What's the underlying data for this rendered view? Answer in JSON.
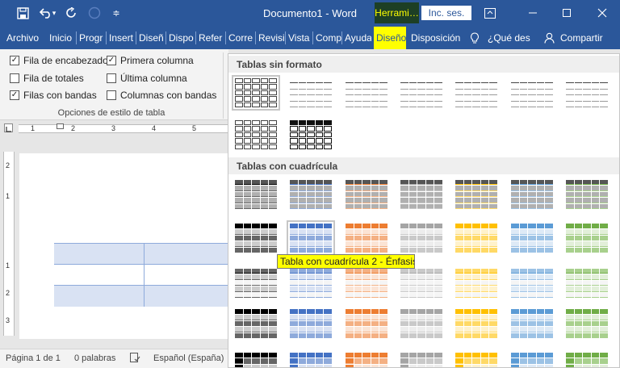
{
  "window": {
    "title": "Documento1  -  Word",
    "contextual_tools": "Herrami…",
    "signin": "Inc. ses."
  },
  "qat": {
    "icons": [
      "save-icon",
      "undo-icon",
      "undo-dropdown-icon",
      "redo-icon",
      "touch-mode-icon",
      "customize-qat-icon"
    ]
  },
  "menu": {
    "tabs": [
      "Archivo",
      "Inicio",
      "Progr",
      "Insert",
      "Diseñ",
      "Dispo",
      "Refer",
      "Corre",
      "Revisi",
      "Vista",
      "Comp",
      "Ayuda",
      "Diseño",
      "Disposición"
    ],
    "active_tab": "Diseño",
    "tell_me": "¿Qué des",
    "share": "Compartir"
  },
  "ribbon": {
    "options": [
      {
        "label": "Fila de encabezado",
        "checked": true
      },
      {
        "label": "Primera columna",
        "checked": true
      },
      {
        "label": "Fila de totales",
        "checked": false
      },
      {
        "label": "Última columna",
        "checked": false
      },
      {
        "label": "Filas con bandas",
        "checked": true
      },
      {
        "label": "Columnas con bandas",
        "checked": false
      }
    ],
    "group_label": "Opciones de estilo de tabla"
  },
  "ruler": {
    "marks": [
      "1",
      "2",
      "3",
      "4",
      "5"
    ],
    "vmarks": [
      "2",
      "1",
      "1",
      "2",
      "3"
    ]
  },
  "status": {
    "page": "Página 1 de 1",
    "words": "0 palabras",
    "language": "Español (España)"
  },
  "gallery": {
    "section_plain": "Tablas sin formato",
    "section_grid": "Tablas con cuadrícula",
    "tooltip": "Tabla con cuadrícula 2 - Énfasis 1"
  },
  "colors": {
    "word_blue": "#2b579a",
    "highlight": "#ffff00",
    "accents": [
      "#000000",
      "#4472c4",
      "#ed7d31",
      "#a5a5a5",
      "#ffc000",
      "#5b9bd5",
      "#70ad47"
    ]
  }
}
